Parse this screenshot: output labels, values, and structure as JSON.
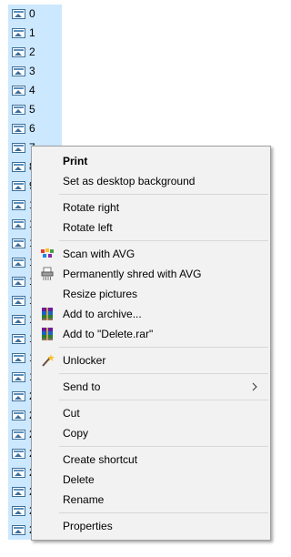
{
  "files": [
    {
      "label": "0"
    },
    {
      "label": "1"
    },
    {
      "label": "2"
    },
    {
      "label": "3"
    },
    {
      "label": "4"
    },
    {
      "label": "5"
    },
    {
      "label": "6"
    },
    {
      "label": "7"
    },
    {
      "label": "8"
    },
    {
      "label": "9"
    },
    {
      "label": "1"
    },
    {
      "label": "1"
    },
    {
      "label": "1"
    },
    {
      "label": "1"
    },
    {
      "label": "1"
    },
    {
      "label": "1"
    },
    {
      "label": "1"
    },
    {
      "label": "1"
    },
    {
      "label": "1"
    },
    {
      "label": "1"
    },
    {
      "label": "2"
    },
    {
      "label": "2"
    },
    {
      "label": "2"
    },
    {
      "label": "2"
    },
    {
      "label": "2"
    },
    {
      "label": "2"
    },
    {
      "label": "2"
    },
    {
      "label": "2"
    }
  ],
  "context_menu": {
    "print": "Print",
    "set_desktop_background": "Set as desktop background",
    "rotate_right": "Rotate right",
    "rotate_left": "Rotate left",
    "scan_avg": "Scan with AVG",
    "shred_avg": "Permanently shred with AVG",
    "resize_pictures": "Resize pictures",
    "add_to_archive": "Add to archive...",
    "add_to_delete_rar": "Add to \"Delete.rar\"",
    "unlocker": "Unlocker",
    "send_to": "Send to",
    "cut": "Cut",
    "copy": "Copy",
    "create_shortcut": "Create shortcut",
    "delete": "Delete",
    "rename": "Rename",
    "properties": "Properties"
  },
  "icons": {
    "file": "image-file-icon",
    "avg": "avg-icon",
    "shredder": "shredder-icon",
    "winrar": "winrar-icon",
    "unlocker": "unlocker-wand-icon",
    "submenu": "chevron-right-icon"
  }
}
